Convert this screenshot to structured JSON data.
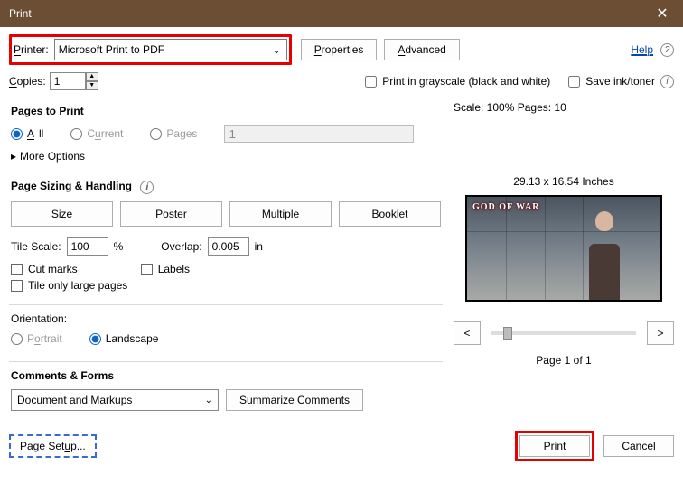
{
  "window": {
    "title": "Print"
  },
  "toolbar": {
    "printer_label": "Printer:",
    "printer_value": "Microsoft Print to PDF",
    "properties": "Properties",
    "advanced": "Advanced",
    "help": "Help"
  },
  "copies": {
    "label": "Copies:",
    "value": "1",
    "grayscale": "Print in grayscale (black and white)",
    "save_ink": "Save ink/toner"
  },
  "pages": {
    "title": "Pages to Print",
    "all": "All",
    "current": "Current",
    "pages": "Pages",
    "pages_value": "1",
    "more": "More Options"
  },
  "sizing": {
    "title": "Page Sizing & Handling",
    "size": "Size",
    "poster": "Poster",
    "multiple": "Multiple",
    "booklet": "Booklet",
    "tile_scale_label": "Tile Scale:",
    "tile_scale_value": "100",
    "percent": "%",
    "overlap_label": "Overlap:",
    "overlap_value": "0.005",
    "overlap_unit": "in",
    "cut_marks": "Cut marks",
    "labels": "Labels",
    "tile_large": "Tile only large pages"
  },
  "orientation": {
    "title": "Orientation:",
    "portrait": "Portrait",
    "landscape": "Landscape"
  },
  "comments": {
    "title": "Comments & Forms",
    "value": "Document and Markups",
    "summarize": "Summarize Comments"
  },
  "preview": {
    "scale_pages": "Scale: 100% Pages: 10",
    "dimensions": "29.13 x 16.54 Inches",
    "page_of": "Page 1 of 1",
    "logo": "GOD OF WAR"
  },
  "footer": {
    "page_setup": "Page Setup...",
    "print": "Print",
    "cancel": "Cancel"
  }
}
